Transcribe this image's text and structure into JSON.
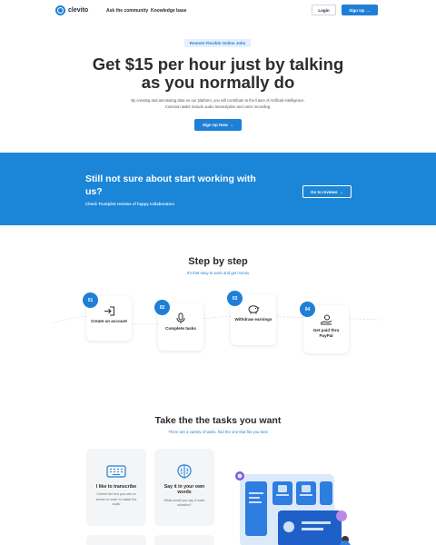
{
  "header": {
    "logo_text": "clevito",
    "nav": [
      "Ask the community",
      "Knowledge base"
    ],
    "login_label": "Login",
    "signup_label": "Sign Up",
    "accent": "#1e7fd6"
  },
  "hero": {
    "badge": "Remote Flexible Online Jobs",
    "title": "Get $15 per hour just by talking as you normally do",
    "subtitle": "By creating and annotating data on our platform, you will contribute to the future of Artificial Intelligence. Common tasks include audio transcription and voice recording.",
    "cta_label": "Sign Up Now"
  },
  "band": {
    "title": "Still not sure about start working with us?",
    "subtitle": "Check Trustpilot reviews of happy collaborators",
    "button_label": "Go to reviews",
    "background": "#1b86d8"
  },
  "steps": {
    "title": "Step by step",
    "subtitle": "It's that easy to work and get money",
    "items": [
      {
        "num": "01",
        "label": "Create an account",
        "icon": "login-icon"
      },
      {
        "num": "02",
        "label": "Complete tasks",
        "icon": "microphone-icon"
      },
      {
        "num": "03",
        "label": "Withdraw earnings",
        "icon": "piggy-bank-icon"
      },
      {
        "num": "04",
        "label": "Get paid thru PayPal",
        "icon": "hand-money-icon"
      }
    ]
  },
  "tasks": {
    "title": "Take the the tasks you want",
    "subtitle": "There are a variety of tasks, find the one that fits you best",
    "items": [
      {
        "title": "I like to transcribe",
        "desc": "Correct the text you see on screen in order to match the audio",
        "icon": "keyboard-icon"
      },
      {
        "title": "Say it in your own words",
        "desc": "What would you say in each situation?",
        "icon": "brain-icon"
      }
    ]
  }
}
